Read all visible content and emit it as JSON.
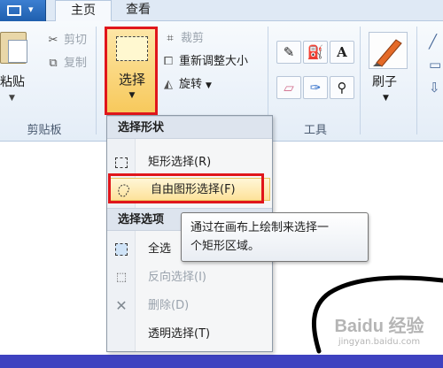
{
  "tabs": {
    "home": "主页",
    "view": "查看"
  },
  "clipboard": {
    "paste": "粘贴",
    "cut": "剪切",
    "copy": "复制",
    "group": "剪贴板"
  },
  "image": {
    "select": "选择",
    "crop": "裁剪",
    "resize": "重新调整大小",
    "rotate": "旋转"
  },
  "tools": {
    "group": "工具",
    "text_icon": "A"
  },
  "brushes": {
    "label": "刷子"
  },
  "menu": {
    "shape_header": "选择形状",
    "rect_select": "矩形选择(R)",
    "free_select": "自由图形选择(F)",
    "options_header": "选择选项",
    "select_all": "全选",
    "invert": "反向选择(I)",
    "delete": "删除(D)",
    "transparent": "透明选择(T)"
  },
  "tooltip": {
    "line1": "通过在画布上绘制来选择一",
    "line2": "个矩形区域。"
  },
  "watermark": {
    "text": "Baidu 经验",
    "url": "jingyan.baidu.com"
  },
  "colors": {
    "highlight_outline": "#e0161b",
    "status_bar": "#3e42c0"
  }
}
